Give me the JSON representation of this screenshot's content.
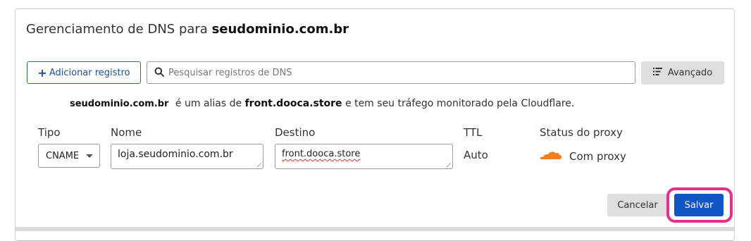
{
  "header": {
    "title_prefix": "Gerenciamento de DNS para",
    "title_domain": "seudominio.com.br"
  },
  "toolbar": {
    "add_label": "Adicionar registro",
    "search_placeholder": "Pesquisar registros de DNS",
    "advanced_label": "Avançado"
  },
  "alias": {
    "domain": "seudominio.com.br",
    "text1": "é um alias de",
    "target": "front.dooca.store",
    "text2": "e tem seu tráfego monitorado pela Cloudflare."
  },
  "form": {
    "labels": {
      "type": "Tipo",
      "name": "Nome",
      "target": "Destino",
      "ttl": "TTL",
      "proxy": "Status do proxy"
    },
    "type_value": "CNAME",
    "name_value": "loja.seudominio.com.br",
    "target_value": "front.dooca.store",
    "ttl_value": "Auto",
    "proxy_value": "Com proxy"
  },
  "actions": {
    "cancel_label": "Cancelar",
    "save_label": "Salvar"
  },
  "colors": {
    "primary": "#0f55c4",
    "highlight": "#e3318c",
    "cloud": "#f38020"
  }
}
